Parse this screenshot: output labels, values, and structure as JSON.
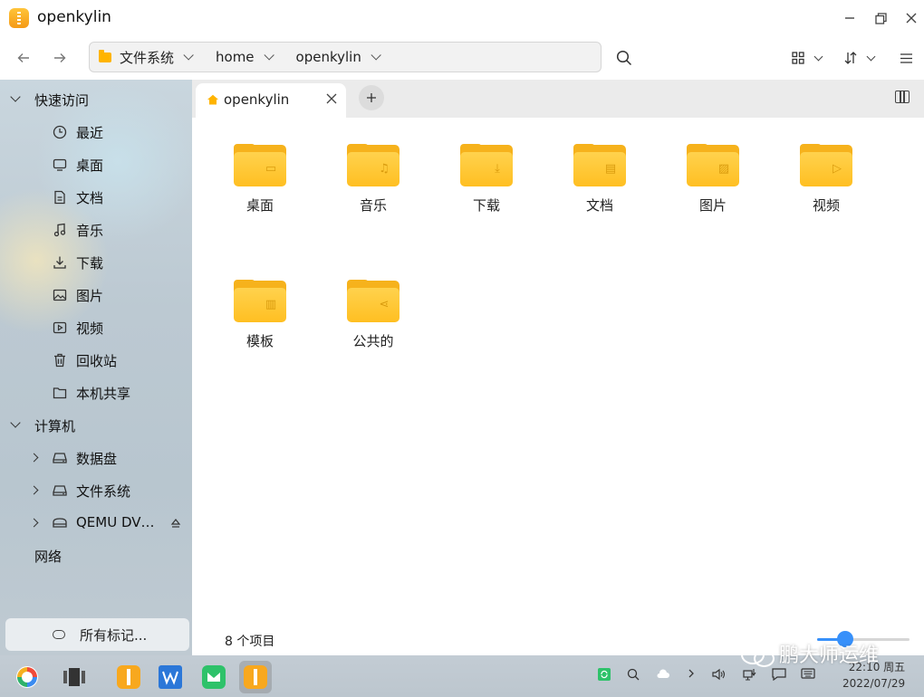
{
  "window": {
    "title": "openkylin"
  },
  "toolbar": {
    "breadcrumbs": [
      "文件系统",
      "home",
      "openkylin"
    ]
  },
  "sidebar": {
    "quick_access": {
      "label": "快速访问",
      "items": [
        "最近",
        "桌面",
        "文档",
        "音乐",
        "下载",
        "图片",
        "视频",
        "回收站",
        "本机共享"
      ]
    },
    "computer": {
      "label": "计算机",
      "items": [
        "数据盘",
        "文件系统",
        "QEMU DV…"
      ]
    },
    "network": {
      "label": "网络"
    },
    "tags_button": "所有标记..."
  },
  "tabs": [
    {
      "label": "openkylin"
    }
  ],
  "folders": [
    {
      "label": "桌面",
      "icon": "desktop-folder-icon"
    },
    {
      "label": "音乐",
      "icon": "music-folder-icon"
    },
    {
      "label": "下载",
      "icon": "download-folder-icon"
    },
    {
      "label": "文档",
      "icon": "documents-folder-icon"
    },
    {
      "label": "图片",
      "icon": "pictures-folder-icon"
    },
    {
      "label": "视频",
      "icon": "video-folder-icon"
    },
    {
      "label": "模板",
      "icon": "templates-folder-icon"
    },
    {
      "label": "公共的",
      "icon": "public-folder-icon"
    }
  ],
  "status": {
    "item_count": "8 个项目",
    "zoom_fraction": 0.3
  },
  "taskbar": {
    "time": "22:10 周五",
    "date": "2022/07/29"
  },
  "watermark": "鹏大师运维",
  "colors": {
    "accent": "#3790fa",
    "folder": "#ffc426"
  }
}
